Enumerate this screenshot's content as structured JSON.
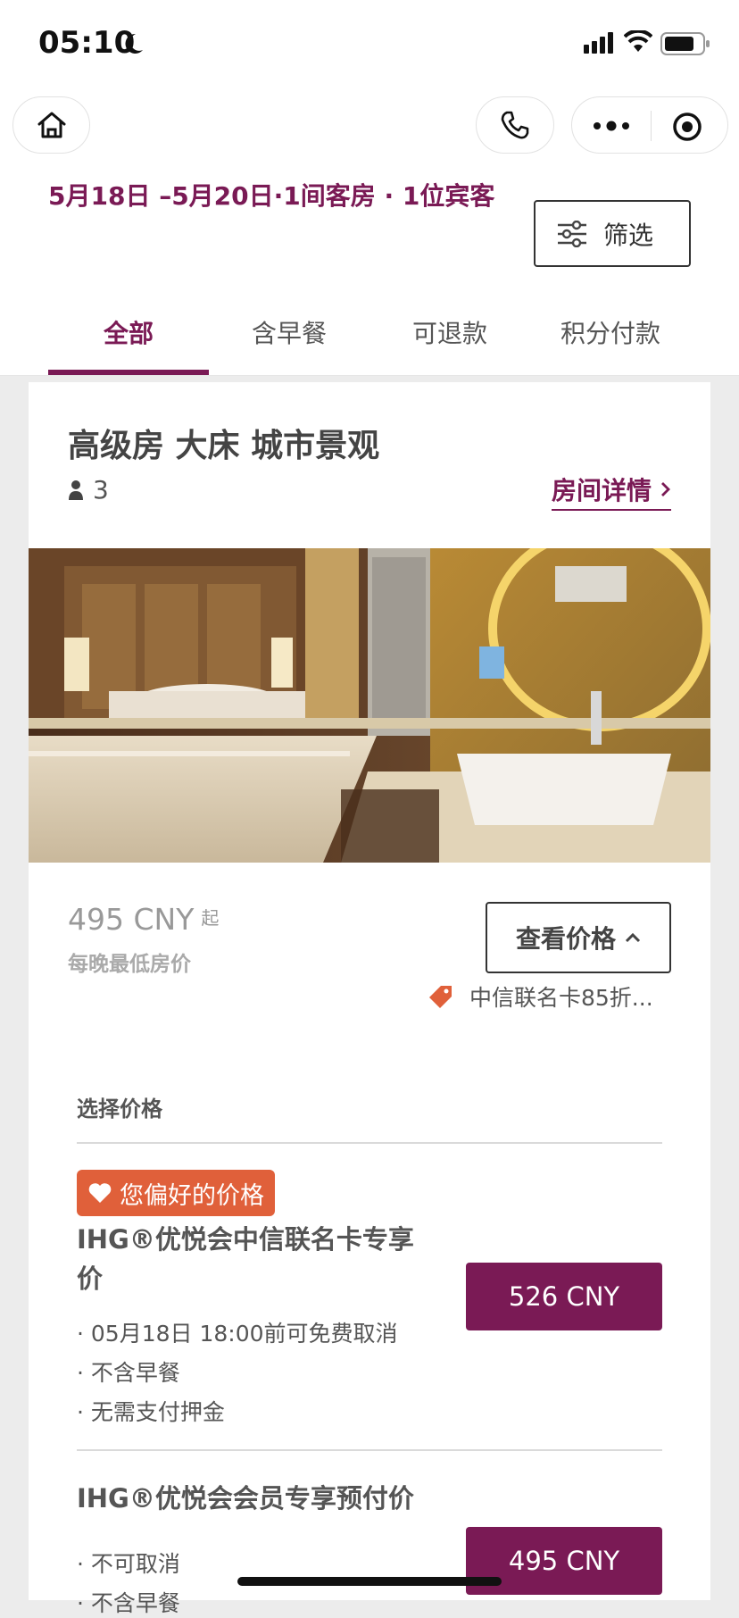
{
  "status": {
    "time": "05:10"
  },
  "booking": {
    "summary": "5月18日 –5月20日·1间客房 · 1位宾客",
    "filter_label": "筛选"
  },
  "tabs": [
    {
      "label": "全部",
      "active": true
    },
    {
      "label": "含早餐",
      "active": false
    },
    {
      "label": "可退款",
      "active": false
    },
    {
      "label": "积分付款",
      "active": false
    }
  ],
  "room": {
    "title": "高级房 大床 城市景观",
    "occupancy": "3",
    "details_link": "房间详情",
    "photo_icon": "hotel-room-photo",
    "price_from": "495 CNY",
    "price_from_suffix": "起",
    "price_note": "每晚最低房价",
    "view_price_label": "查看价格",
    "promo_text": "中信联名卡85折..."
  },
  "rates": {
    "title": "选择价格",
    "items": [
      {
        "badge": "您偏好的价格",
        "name": "IHG®优悦会中信联名卡专享价",
        "features": [
          "· 05月18日 18:00前可免费取消",
          "· 不含早餐",
          "· 无需支付押金"
        ],
        "price": "526 CNY"
      },
      {
        "name": "IHG®优悦会会员专享预付价",
        "features": [
          "· 不可取消",
          "· 不含早餐"
        ],
        "price": "495 CNY"
      }
    ]
  },
  "colors": {
    "brand": "#7a1a55",
    "badge": "#e0603a",
    "promo_tag": "#e0603a"
  }
}
